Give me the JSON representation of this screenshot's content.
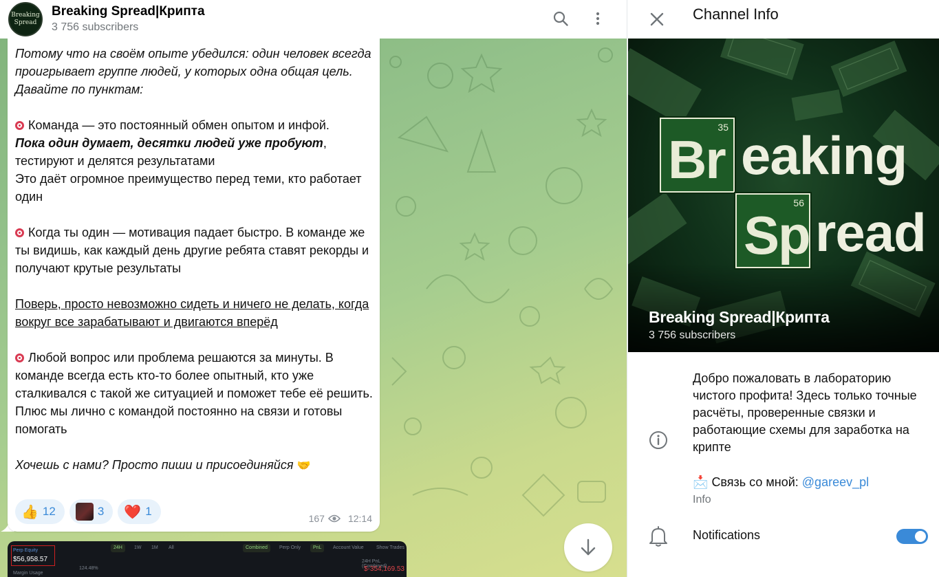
{
  "chat": {
    "title": "Breaking Spread|Крипта",
    "subscribers": "3 756 subscribers",
    "avatar_text": [
      "Breaking",
      "Spread"
    ],
    "message": {
      "intro": "Потому что на своём опыте убедился: один человек всегда проигрывает группе людей, у которых одна общая цель. Давайте по пунктам:",
      "point1_a": "Команда — это постоянный обмен опытом и инфой.",
      "point1_bold": "Пока один думает, десятки людей уже пробуют",
      "point1_b": ", тестируют и делятся результатами",
      "point1_c": "Это даёт огромное преимущество перед теми, кто работает один",
      "point2": "Когда ты один — мотивация падает быстро. В команде же ты видишь, как каждый день другие ребята ставят рекорды и получают крутые результаты",
      "underlined": "Поверь, просто невозможно сидеть и ничего не делать, когда вокруг все зарабатывают и двигаются вперёд",
      "point3": "Любой вопрос или проблема решаются за минуты. В команде всегда есть кто-то более опытный, кто уже сталкивался с такой же ситуацией и поможет тебе её решить. Плюс мы лично с командой постоянно на связи и готовы помогать",
      "outro": "Хочешь с нами? Просто пиши и присоединяйся",
      "outro_emoji": "🤝",
      "views": "167",
      "time": "12:14"
    },
    "reactions": [
      {
        "emoji": "👍",
        "count": "12"
      },
      {
        "emoji": "",
        "count": "3"
      },
      {
        "emoji": "❤️",
        "count": "1"
      }
    ],
    "preview": {
      "perp_equity_label": "Perp Equity",
      "perp_equity_value": "$56,958.57",
      "margin_label": "Margin Usage",
      "margin_value": "124.48%",
      "tabs": [
        "24H",
        "1W",
        "1M",
        "All"
      ],
      "pills": [
        "Combined",
        "Perp Only",
        "PnL",
        "Account Value",
        "Show Trades"
      ],
      "pnl_label": "24H PnL (Combined)",
      "pnl_value": "$-354,169.53"
    }
  },
  "info": {
    "title": "Channel Info",
    "cover_logo": {
      "el1_num": "35",
      "el1_sym": "Br",
      "el1_rest": "eaking",
      "el2_num": "56",
      "el2_sym": "Sp",
      "el2_rest": "read"
    },
    "name": "Breaking Spread|Крипта",
    "subscribers": "3 756 subscribers",
    "description": "Добро пожаловать в лабораторию чистого профита! Здесь только точные расчёты, проверенные связки и работающие схемы для заработка на крипте",
    "contact_emoji": "📩",
    "contact_label": "Связь со мной: ",
    "contact_link": "@gareev_pl",
    "info_label": "Info",
    "notifications_label": "Notifications",
    "notifications_on": true
  },
  "colors": {
    "accent": "#3a8ad8",
    "chat_bg": "#a6cd8f"
  }
}
